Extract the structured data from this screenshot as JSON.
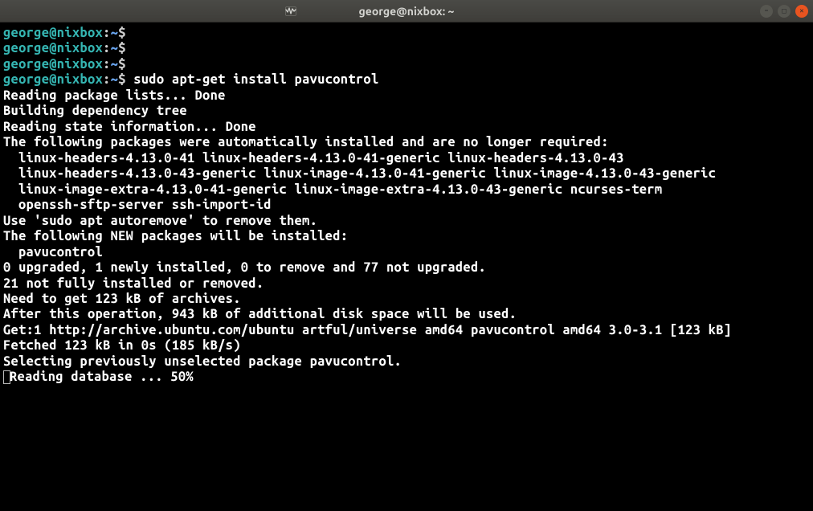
{
  "window": {
    "title": "george@nixbox: ~"
  },
  "prompt": {
    "user_host": "george@nixbox",
    "separator": ":",
    "path": "~",
    "symbol": "$"
  },
  "commands": {
    "sudo_install": "sudo apt-get install pavucontrol"
  },
  "output": {
    "l1": "Reading package lists... Done",
    "l2": "Building dependency tree",
    "l3": "Reading state information... Done",
    "l4": "The following packages were automatically installed and are no longer required:",
    "l5": "linux-headers-4.13.0-41 linux-headers-4.13.0-41-generic linux-headers-4.13.0-43",
    "l6": "linux-headers-4.13.0-43-generic linux-image-4.13.0-41-generic linux-image-4.13.0-43-generic",
    "l7": "linux-image-extra-4.13.0-41-generic linux-image-extra-4.13.0-43-generic ncurses-term",
    "l8": "openssh-sftp-server ssh-import-id",
    "l9": "Use 'sudo apt autoremove' to remove them.",
    "l10": "The following NEW packages will be installed:",
    "l11": "pavucontrol",
    "l12": "0 upgraded, 1 newly installed, 0 to remove and 77 not upgraded.",
    "l13": "21 not fully installed or removed.",
    "l14": "Need to get 123 kB of archives.",
    "l15": "After this operation, 943 kB of additional disk space will be used.",
    "l16": "Get:1 http://archive.ubuntu.com/ubuntu artful/universe amd64 pavucontrol amd64 3.0-3.1 [123 kB]",
    "l17": "Fetched 123 kB in 0s (185 kB/s)",
    "l18": "Selecting previously unselected package pavucontrol.",
    "l19": "Reading database ... 50%"
  }
}
